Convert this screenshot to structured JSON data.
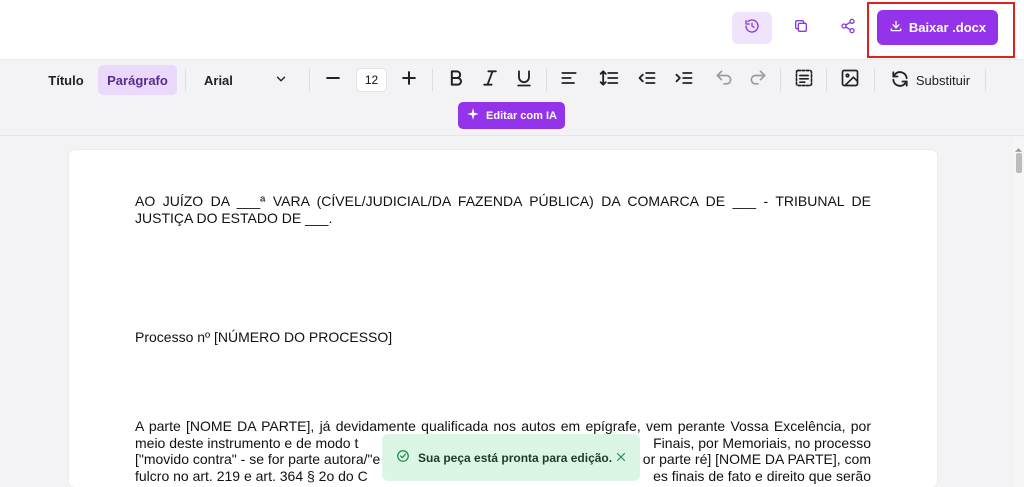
{
  "topbar": {
    "history_icon": "history-icon",
    "copy_icon": "copy-icon",
    "share_icon": "share-icon",
    "download_label": "Baixar .docx",
    "download_icon": "download-icon"
  },
  "toolbar": {
    "style_title": "Título",
    "style_paragraph": "Parágrafo",
    "font": "Arial",
    "font_size": "12",
    "replace_label": "Substituir",
    "ai_label": "Editar com IA"
  },
  "document": {
    "p1": "AO JUÍZO DA ___ª VARA (CÍVEL/JUDICIAL/DA FAZENDA PÚBLICA) DA COMARCA DE ___ - TRIBUNAL DE JUSTIÇA DO ESTADO DE ___.",
    "p2": "Processo nº [NÚMERO DO PROCESSO]",
    "p3_line1": "A parte [NOME DA PARTE], já devidamente qualificada nos autos em epígrafe, vem perante Vossa Excelência, por",
    "p3_line2": "meio deste instrumento e de modo t",
    "p3_line2b": "Finais, por Memoriais, no processo",
    "p3_line3": "[\"movido contra\" - se for parte autora/\"e",
    "p3_line3b": "or parte ré] [NOME DA PARTE], com",
    "p3_line4": "fulcro no art. 219 e art. 364 § 2o do C",
    "p3_line4b": "es finais de fato e direito que serão"
  },
  "toast": {
    "message": "Sua peça está pronta para edição."
  },
  "colors": {
    "accent": "#9333ea",
    "highlight_border": "#e0201c",
    "toast_bg": "#dcf6e6"
  }
}
